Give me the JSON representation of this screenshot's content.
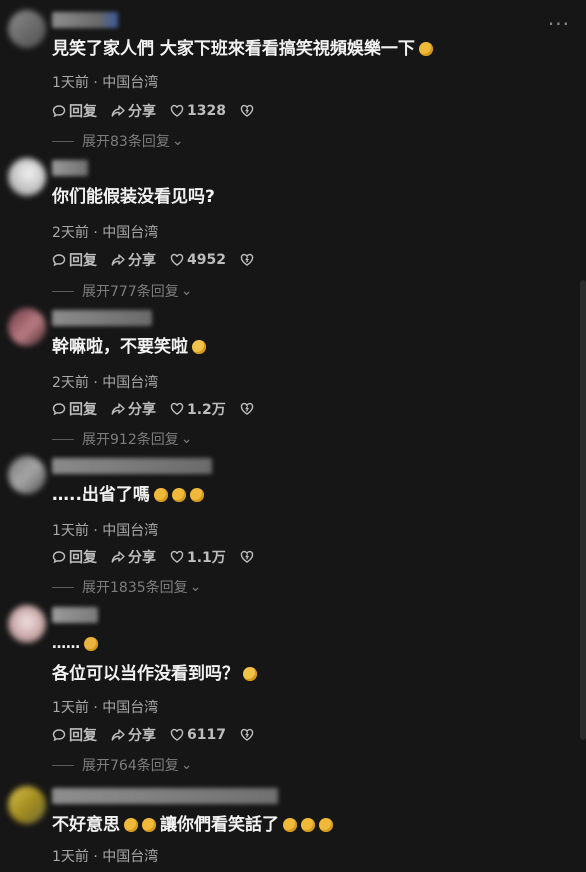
{
  "comments": [
    {
      "content": "見笑了家人們 大家下班來看看搞笑視頻娛樂一下",
      "emoji_count": 1,
      "meta": "1天前 · 中国台湾",
      "reply_label": "回复",
      "share_label": "分享",
      "likes": "1328",
      "expand": "展开83条回复"
    },
    {
      "content": "你们能假装没看见吗?",
      "emoji_count": 0,
      "meta": "2天前 · 中国台湾",
      "reply_label": "回复",
      "share_label": "分享",
      "likes": "4952",
      "expand": "展开777条回复"
    },
    {
      "content": "幹嘛啦，不要笑啦",
      "emoji_count": 1,
      "meta": "2天前 · 中国台湾",
      "reply_label": "回复",
      "share_label": "分享",
      "likes": "1.2万",
      "expand": "展开912条回复"
    },
    {
      "content": "…..出省了嗎",
      "emoji_count": 3,
      "meta": "1天前 · 中国台湾",
      "reply_label": "回复",
      "share_label": "分享",
      "likes": "1.1万",
      "expand": "展开1835条回复"
    },
    {
      "content_line1": "……",
      "content": "各位可以当作没看到吗？",
      "emoji_count": 1,
      "meta": "1天前 · 中国台湾",
      "reply_label": "回复",
      "share_label": "分享",
      "likes": "6117",
      "expand": "展开764条回复"
    },
    {
      "content_part1": "不好意思",
      "content_part2": "讓你們看笑話了",
      "meta": "1天前 · 中国台湾"
    }
  ],
  "colors": {
    "background": "#161616",
    "text": "#f2f2f2",
    "meta": "#a8a8a8"
  },
  "icons": [
    "more-icon",
    "comment-icon",
    "share-icon",
    "heart-icon",
    "dislike-heart-icon",
    "chevron-down-icon"
  ]
}
